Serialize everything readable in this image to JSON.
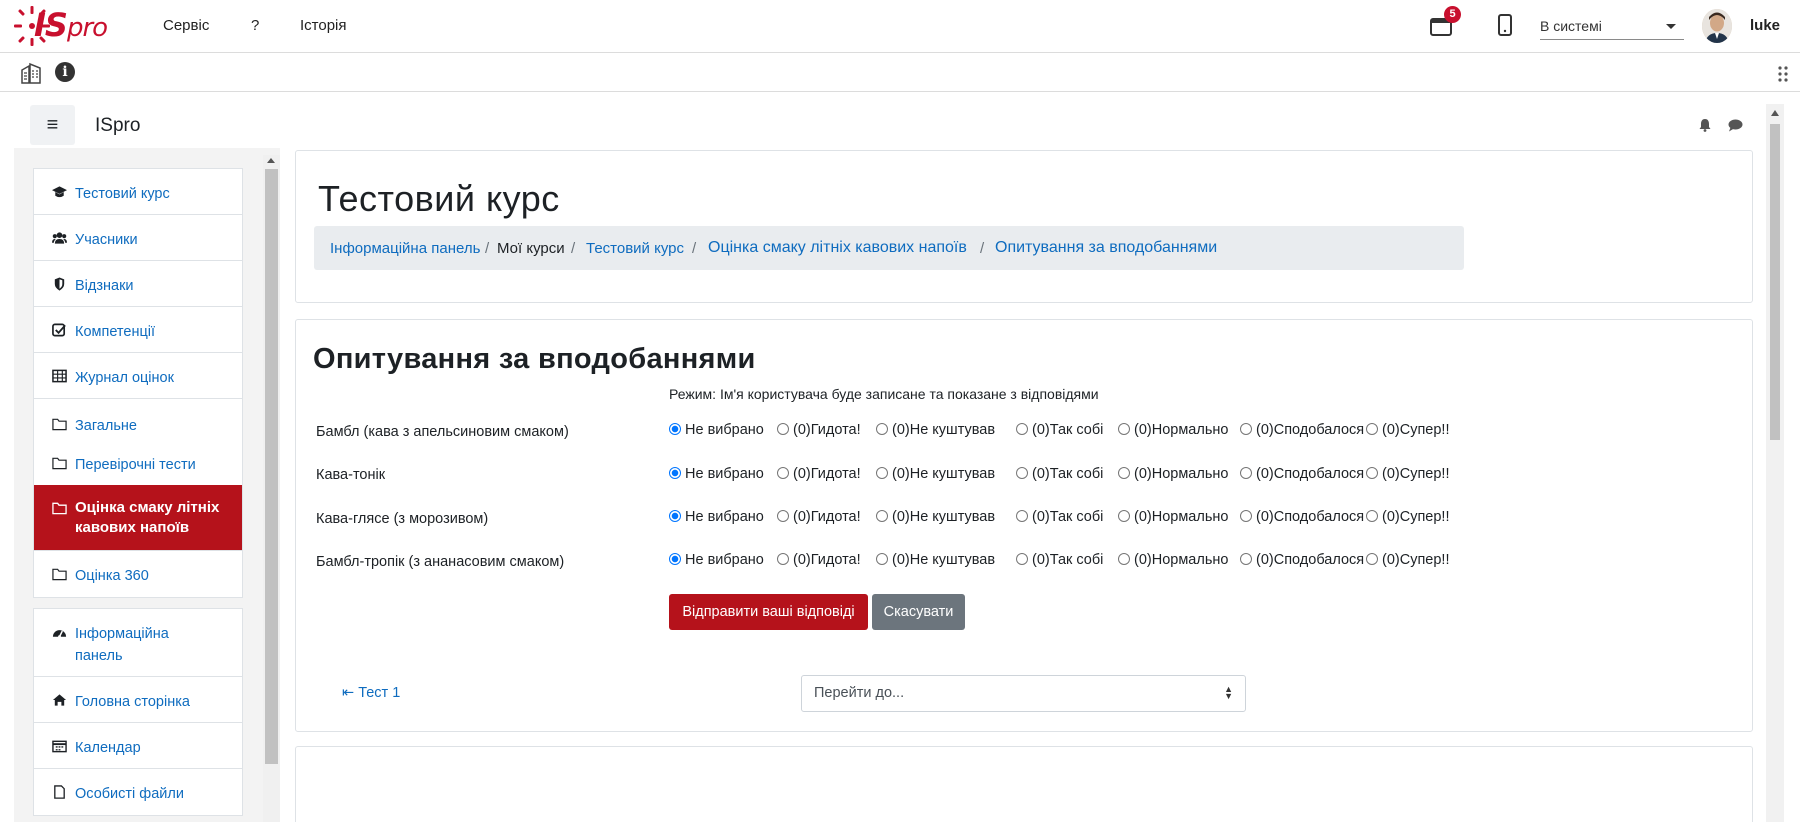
{
  "app": {
    "menu": [
      "Сервіс",
      "?",
      "Історія"
    ],
    "calendar_badge": "5",
    "status_value": "В системі",
    "username": "luke",
    "brand_color": "#c8102e"
  },
  "moodle": {
    "site_name": "ISpro"
  },
  "nav": {
    "group1": [
      {
        "label": "Тестовий курс",
        "icon": "graduation-cap-icon"
      },
      {
        "label": "Учасники",
        "icon": "users-icon"
      },
      {
        "label": "Відзнаки",
        "icon": "shield-icon"
      },
      {
        "label": "Компетенції",
        "icon": "checkbox-icon"
      },
      {
        "label": "Журнал оцінок",
        "icon": "table-icon"
      },
      {
        "label": "Загальне",
        "icon": "folder-icon"
      },
      {
        "label": "Перевірочні тести",
        "icon": "folder-icon"
      },
      {
        "label": "Оцінка смаку літніх кавових напоїв",
        "icon": "folder-icon",
        "active": true
      },
      {
        "label": "Оцінка 360",
        "icon": "folder-icon"
      }
    ],
    "group2": [
      {
        "label": "Інформаційна панель",
        "icon": "dashboard-icon"
      },
      {
        "label": "Головна сторінка",
        "icon": "home-icon"
      },
      {
        "label": "Календар",
        "icon": "calendar-icon"
      },
      {
        "label": "Особисті файли",
        "icon": "file-icon"
      }
    ],
    "active_color": "#b5121b"
  },
  "course": {
    "title": "Тестовий курс",
    "breadcrumb": [
      {
        "label": "Інформаційна панель",
        "link": true
      },
      {
        "label": "Мої курси",
        "link": false
      },
      {
        "label": "Тестовий курс",
        "link": true
      },
      {
        "label": "Оцінка смаку літніх кавових напоїв",
        "link": true
      },
      {
        "label": "Опитування за вподобаннями",
        "link": true
      }
    ]
  },
  "survey": {
    "title": "Опитування за вподобаннями",
    "mode": "Режим: Ім'я користувача буде записане та показане з відповідями",
    "questions": [
      "Бамбл (кава з апельсиновим смаком)",
      "Кава-тонік",
      "Кава-глясе (з морозивом)",
      "Бамбл-тропік (з ананасовим смаком)"
    ],
    "options": [
      {
        "count": "",
        "label": "Не вибрано"
      },
      {
        "count": "(0)",
        "label": "Гидота!"
      },
      {
        "count": "(0)",
        "label": "Не куштував"
      },
      {
        "count": "(0)",
        "label": "Так собі"
      },
      {
        "count": "(0)",
        "label": "Нормально"
      },
      {
        "count": "(0)",
        "label": "Сподобалося"
      },
      {
        "count": "(0)",
        "label": "Супер!!"
      }
    ],
    "submit_label": "Відправити ваші відповіді",
    "cancel_label": "Скасувати",
    "prev_link": "Тест 1",
    "jump_placeholder": "Перейти до..."
  }
}
